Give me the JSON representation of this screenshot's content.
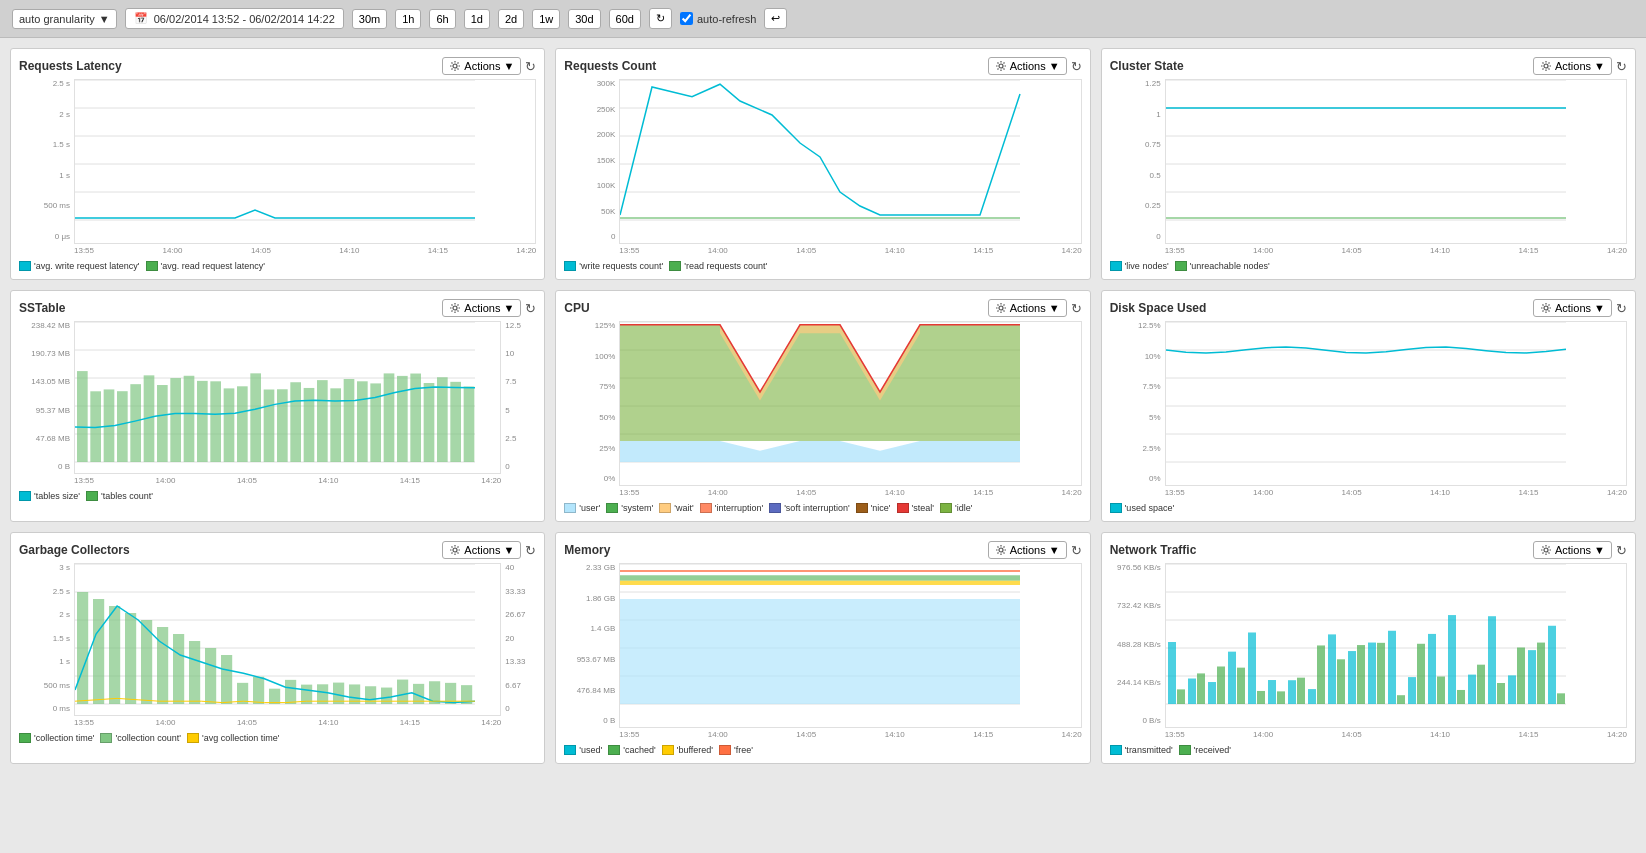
{
  "topbar": {
    "granularity": "auto granularity",
    "daterange": "06/02/2014 13:52 - 06/02/2014 14:22",
    "timebtns": [
      "30m",
      "1h",
      "6h",
      "1d",
      "2d",
      "1w",
      "30d",
      "60d"
    ],
    "autorefresh": "auto-refresh",
    "actions_label": "Actions"
  },
  "panels": [
    {
      "id": "requests-latency",
      "title": "Requests Latency",
      "yaxis": [
        "2.5 s",
        "2 s",
        "1.5 s",
        "1 s",
        "500 ms",
        "0 μs"
      ],
      "xaxis": [
        "13:55",
        "14:00",
        "14:05",
        "14:10",
        "14:15",
        "14:20"
      ],
      "legend": [
        {
          "color": "#00bcd4",
          "label": "'avg. write request latency'"
        },
        {
          "color": "#4caf50",
          "label": "'avg. read request latency'"
        }
      ],
      "type": "line_flat"
    },
    {
      "id": "requests-count",
      "title": "Requests Count",
      "yaxis": [
        "300K",
        "250K",
        "200K",
        "150K",
        "100K",
        "50K",
        "0"
      ],
      "xaxis": [
        "13:55",
        "14:00",
        "14:05",
        "14:10",
        "14:15",
        "14:20"
      ],
      "legend": [
        {
          "color": "#00bcd4",
          "label": "'write requests count'"
        },
        {
          "color": "#4caf50",
          "label": "'read requests count'"
        }
      ],
      "type": "line_spiky"
    },
    {
      "id": "cluster-state",
      "title": "Cluster State",
      "yaxis": [
        "1.25",
        "1",
        "0.75",
        "0.5",
        "0.25",
        "0"
      ],
      "xaxis": [
        "13:55",
        "14:00",
        "14:05",
        "14:10",
        "14:15",
        "14:20"
      ],
      "legend": [
        {
          "color": "#00bcd4",
          "label": "'live nodes'"
        },
        {
          "color": "#4caf50",
          "label": "'unreachable nodes'"
        }
      ],
      "type": "line_flat_high"
    },
    {
      "id": "sstable",
      "title": "SSTable",
      "yaxis": [
        "238.42 MB",
        "190.73 MB",
        "143.05 MB",
        "95.37 MB",
        "47.68 MB",
        "0 B"
      ],
      "yaxis2": [
        "12.5",
        "10",
        "7.5",
        "5",
        "2.5",
        "0"
      ],
      "xaxis": [
        "13:55",
        "14:00",
        "14:05",
        "14:10",
        "14:15",
        "14:20"
      ],
      "legend": [
        {
          "color": "#00bcd4",
          "label": "'tables size'"
        },
        {
          "color": "#4caf50",
          "label": "'tables count'"
        }
      ],
      "type": "bar_line"
    },
    {
      "id": "cpu",
      "title": "CPU",
      "yaxis": [
        "125%",
        "100%",
        "75%",
        "50%",
        "25%",
        "0%"
      ],
      "xaxis": [
        "13:55",
        "14:00",
        "14:05",
        "14:10",
        "14:15",
        "14:20"
      ],
      "legend": [
        {
          "color": "#b3e5fc",
          "label": "'user'"
        },
        {
          "color": "#4caf50",
          "label": "'system'"
        },
        {
          "color": "#ffcc80",
          "label": "'wait'"
        },
        {
          "color": "#ff8a65",
          "label": "'interruption'"
        },
        {
          "color": "#5c6bc0",
          "label": "'soft interruption'"
        },
        {
          "color": "#9c5e1a",
          "label": "'nice'"
        },
        {
          "color": "#e53935",
          "label": "'steal'"
        },
        {
          "color": "#7cb342",
          "label": "'idle'"
        }
      ],
      "type": "area_stacked"
    },
    {
      "id": "disk-space",
      "title": "Disk Space Used",
      "yaxis": [
        "12.5%",
        "10%",
        "7.5%",
        "5%",
        "2.5%",
        "0%"
      ],
      "xaxis": [
        "13:55",
        "14:00",
        "14:05",
        "14:10",
        "14:15",
        "14:20"
      ],
      "legend": [
        {
          "color": "#00bcd4",
          "label": "'used space'"
        }
      ],
      "type": "line_flat_mid"
    },
    {
      "id": "gc",
      "title": "Garbage Collectors",
      "yaxis": [
        "3 s",
        "2.5 s",
        "2 s",
        "1.5 s",
        "1 s",
        "500 ms",
        "0 ms"
      ],
      "yaxis2": [
        "40",
        "33.33",
        "26.67",
        "20",
        "13.33",
        "6.67",
        "0"
      ],
      "xaxis": [
        "13:55",
        "14:00",
        "14:05",
        "14:10",
        "14:15",
        "14:20"
      ],
      "legend": [
        {
          "color": "#4caf50",
          "label": "'collection time'"
        },
        {
          "color": "#81c784",
          "label": "'collection count'"
        },
        {
          "color": "#ffcc02",
          "label": "'avg collection time'"
        }
      ],
      "type": "bar_line_gc"
    },
    {
      "id": "memory",
      "title": "Memory",
      "yaxis": [
        "2.33 GB",
        "1.86 GB",
        "1.4 GB",
        "953.67 MB",
        "476.84 MB",
        "0 B"
      ],
      "xaxis": [
        "13:55",
        "14:00",
        "14:05",
        "14:10",
        "14:15",
        "14:20"
      ],
      "legend": [
        {
          "color": "#00bcd4",
          "label": "'used'"
        },
        {
          "color": "#4caf50",
          "label": "'cached'"
        },
        {
          "color": "#ffcc02",
          "label": "'buffered'"
        },
        {
          "color": "#ff7043",
          "label": "'free'"
        }
      ],
      "type": "area_memory"
    },
    {
      "id": "network",
      "title": "Network Traffic",
      "yaxis": [
        "976.56 KB/s",
        "732.42 KB/s",
        "488.28 KB/s",
        "244.14 KB/s",
        "0 B/s"
      ],
      "xaxis": [
        "13:55",
        "14:00",
        "14:05",
        "14:10",
        "14:15",
        "14:20"
      ],
      "legend": [
        {
          "color": "#00bcd4",
          "label": "'transmitted'"
        },
        {
          "color": "#4caf50",
          "label": "'received'"
        }
      ],
      "type": "bar_network"
    }
  ]
}
